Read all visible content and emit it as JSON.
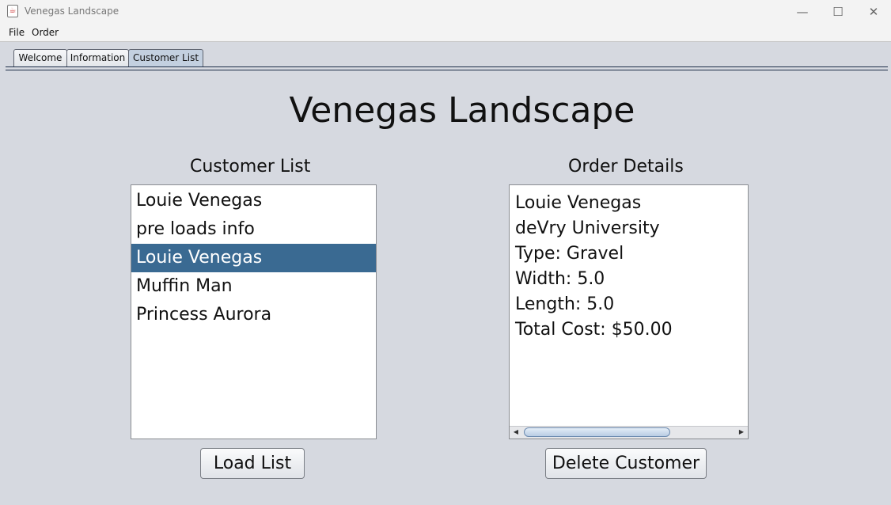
{
  "window": {
    "title": "Venegas Landscape",
    "icon": "java-cup-icon",
    "minimize_glyph": "—",
    "maximize_glyph": "☐",
    "close_glyph": "✕"
  },
  "menu": {
    "items": [
      "File",
      "Order"
    ]
  },
  "tabs": [
    {
      "label": "Welcome",
      "active": false
    },
    {
      "label": "Information",
      "active": false
    },
    {
      "label": "Customer List",
      "active": true
    }
  ],
  "main": {
    "heading": "Venegas Landscape",
    "customer_list": {
      "title": "Customer List",
      "items": [
        "Louie Venegas",
        "pre loads info",
        "Louie Venegas",
        "Muffin Man",
        "Princess Aurora"
      ],
      "selected_index": 2
    },
    "order_details": {
      "title": "Order Details",
      "lines": [
        "Louie Venegas",
        "deVry University",
        "Type: Gravel",
        "Width: 5.0",
        "Length: 5.0",
        "Total Cost: $50.00"
      ]
    },
    "load_button": "Load List",
    "delete_button": "Delete Customer"
  },
  "colors": {
    "selection": "#3a6a92",
    "background": "#d6d9e0"
  }
}
